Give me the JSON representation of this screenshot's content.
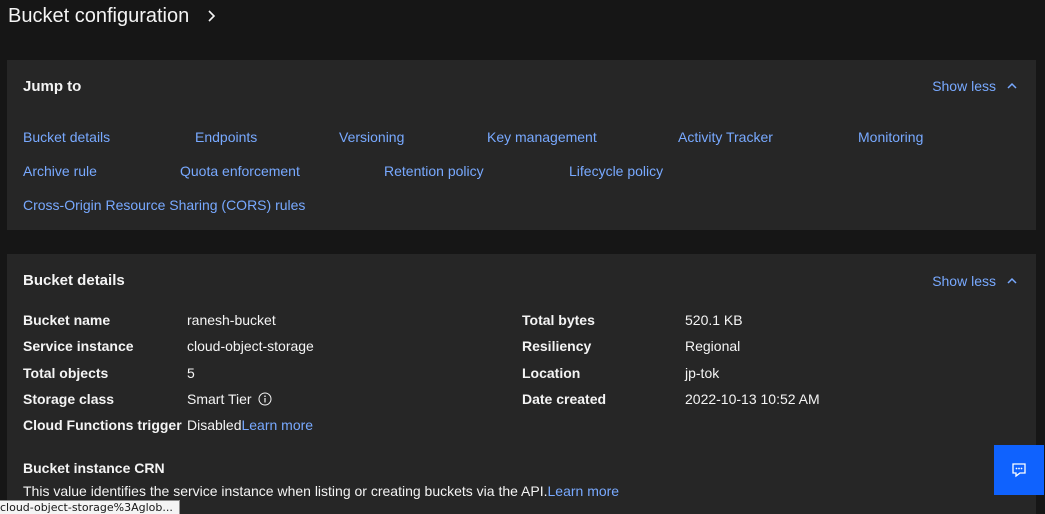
{
  "header": {
    "title": "Bucket configuration",
    "chevron_icon": "chevron-right-icon"
  },
  "jump_to": {
    "heading": "Jump to",
    "toggle_label": "Show less",
    "links": [
      "Bucket details",
      "Endpoints",
      "Versioning",
      "Key management",
      "Activity Tracker",
      "Monitoring",
      "Archive rule",
      "Quota enforcement",
      "Retention policy",
      "Lifecycle policy",
      "Cross-Origin Resource Sharing (CORS) rules"
    ]
  },
  "bucket_details": {
    "heading": "Bucket details",
    "toggle_label": "Show less",
    "left": [
      {
        "label": "Bucket name",
        "value": "ranesh-bucket"
      },
      {
        "label": "Service instance",
        "value": "cloud-object-storage"
      },
      {
        "label": "Total objects",
        "value": "5"
      },
      {
        "label": "Storage class",
        "value": "Smart Tier"
      },
      {
        "label": "Cloud Functions trigger",
        "value": "Disabled",
        "link": "Learn more"
      }
    ],
    "right": [
      {
        "label": "Total bytes",
        "value": "520.1 KB"
      },
      {
        "label": "Resiliency",
        "value": "Regional"
      },
      {
        "label": "Location",
        "value": "jp-tok"
      },
      {
        "label": "Date created",
        "value": "2022-10-13 10:52 AM"
      }
    ],
    "crn": {
      "title": "Bucket instance CRN",
      "description": "This value identifies the service instance when listing or creating buckets via the API.",
      "link": "Learn more"
    }
  },
  "status_bar": {
    "url": "cloud-object-storage%3Aglob..."
  },
  "colors": {
    "background": "#161616",
    "tile": "#262626",
    "link": "#78a9ff",
    "accent": "#0f62fe"
  }
}
